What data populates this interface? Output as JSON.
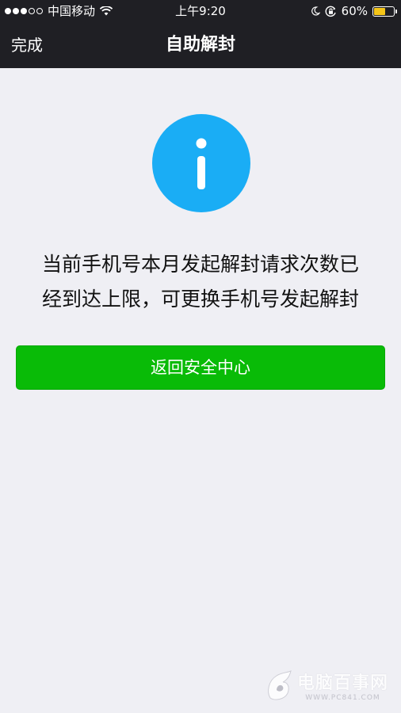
{
  "status_bar": {
    "carrier": "中国移动",
    "time": "上午9:20",
    "battery_percent": "60%",
    "battery_level": 0.6,
    "signal_bars_filled": 3,
    "signal_bars_total": 5,
    "icons": [
      "signal-dots-icon",
      "wifi-icon",
      "moon-icon",
      "orientation-lock-icon",
      "battery-icon"
    ]
  },
  "nav": {
    "back_label": "完成",
    "title": "自助解封"
  },
  "main": {
    "icon": "info-icon",
    "icon_color": "#1aadf5",
    "message_line1": "当前手机号本月发起解封请求次数已",
    "message_line2": "经到达上限，可更换手机号发起解封",
    "button_label": "返回安全中心",
    "button_color": "#09bb07"
  },
  "watermark": {
    "brand": "电脑百事网",
    "site": "WWW.PC841.COM"
  }
}
